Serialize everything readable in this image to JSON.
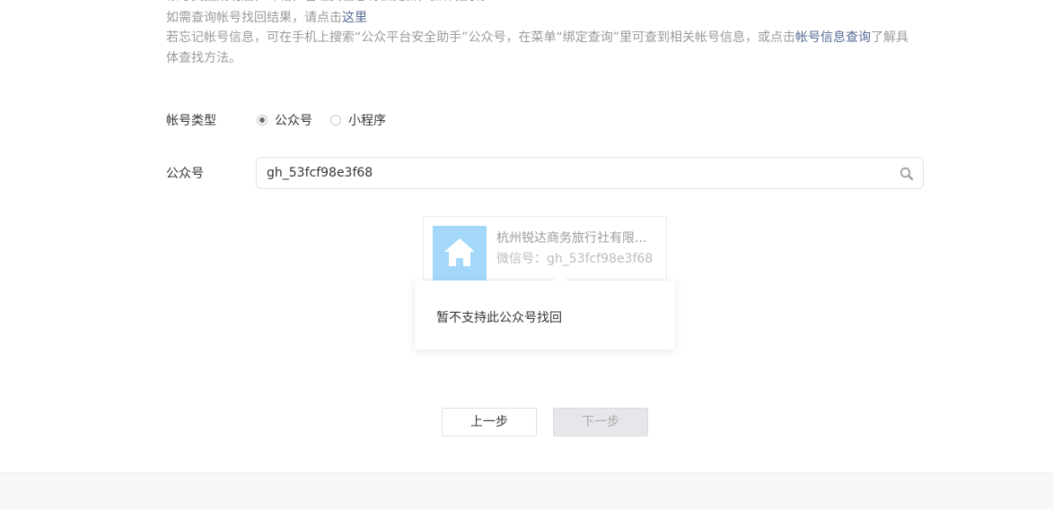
{
  "notice": {
    "line0": "帐号找回成功后，邮箱，管理员信息将会更新，操作指引。",
    "line1_prefix": "如需查询帐号找回结果，请点击",
    "line1_link": "这里",
    "line2_prefix": "若忘记帐号信息，可在手机上搜索“公众平台安全助手”公众号，在菜单“绑定查询”里可查到相关帐号信息，或点击",
    "line2_link": "帐号信息查询",
    "line2_suffix": "了解具体查找方法。"
  },
  "form": {
    "account_type_label": "帐号类型",
    "options": [
      {
        "label": "公众号",
        "checked": true
      },
      {
        "label": "小程序",
        "checked": false
      }
    ],
    "account_label": "公众号",
    "search_value": "gh_53fcf98e3f68"
  },
  "result": {
    "name": "杭州锐达商务旅行社有限...",
    "wxid": "微信号：gh_53fcf98e3f68"
  },
  "popup": {
    "message": "暂不支持此公众号找回"
  },
  "buttons": {
    "prev": "上一步",
    "next": "下一步"
  },
  "colors": {
    "link": "#576b95",
    "avatar_bg": "#a4d8fb",
    "disabled_btn": "#e7e7eb"
  }
}
